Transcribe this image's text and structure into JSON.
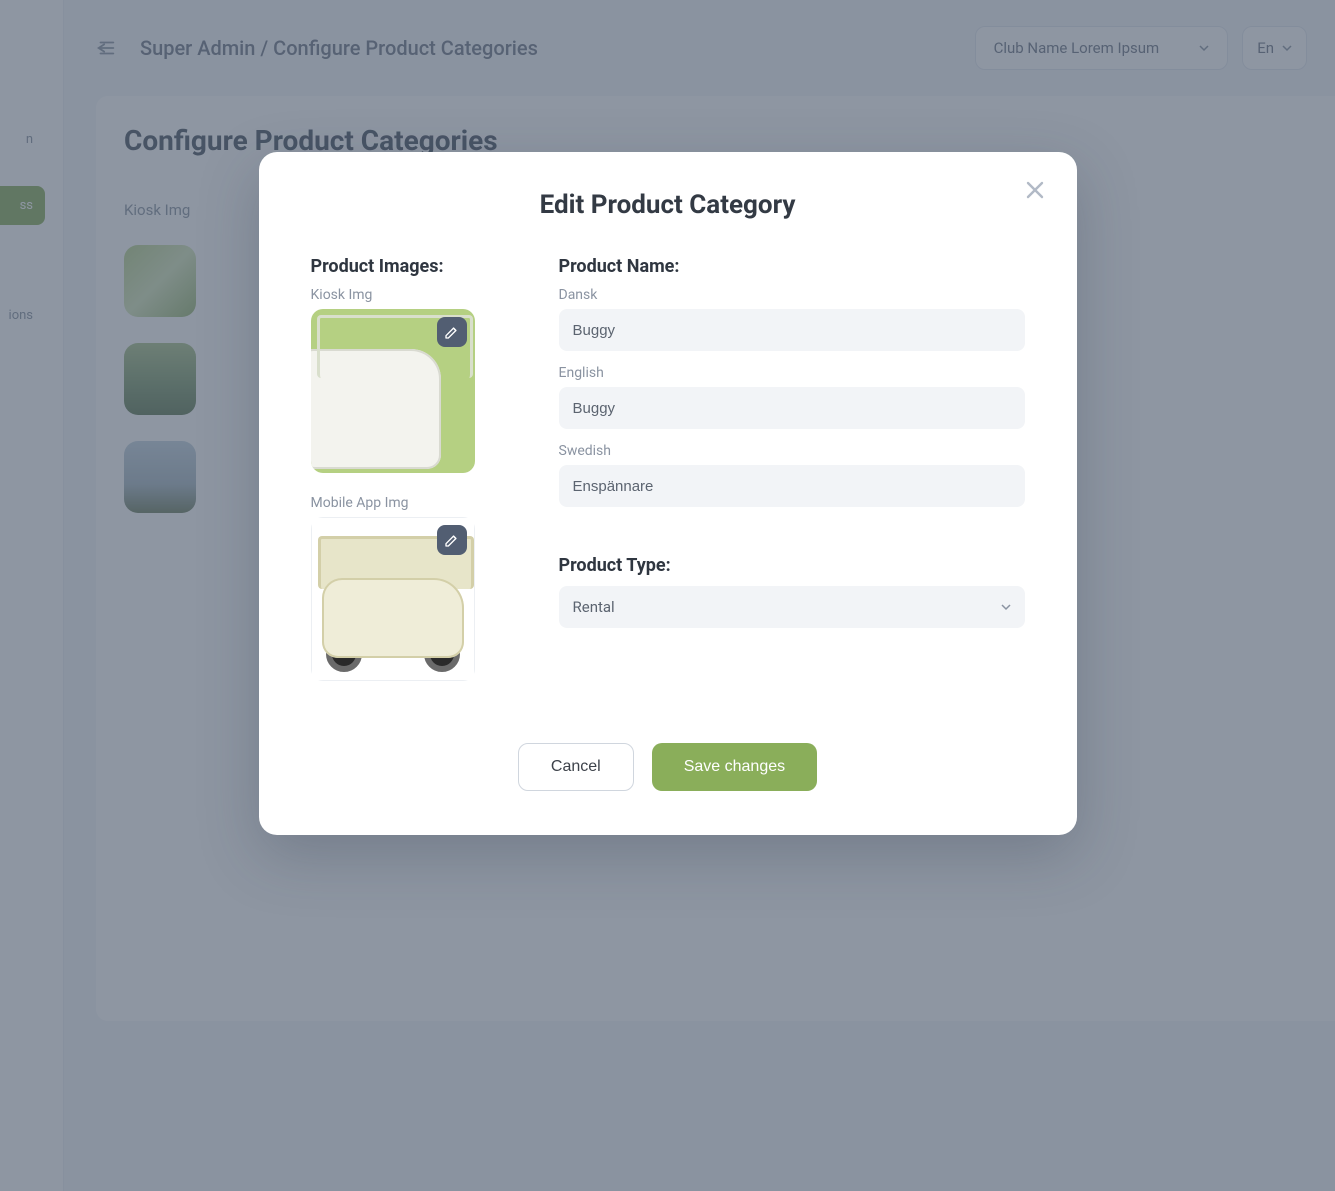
{
  "header": {
    "breadcrumb": "Super Admin / Configure Product Categories",
    "club_selector": "Club Name Lorem Ipsum",
    "lang_selector": "En"
  },
  "sidebar": {
    "item_partial_1": "n",
    "item_active": "ss",
    "item_partial_2": "ions"
  },
  "page": {
    "title": "Configure Product Categories",
    "thumb_col_label": "Kiosk Img"
  },
  "modal": {
    "title": "Edit Product Category",
    "images_section_label": "Product Images:",
    "kiosk_img_label": "Kiosk Img",
    "mobile_img_label": "Mobile App Img",
    "product_name_section_label": "Product Name:",
    "name_fields": {
      "dansk_label": "Dansk",
      "dansk_value": "Buggy",
      "english_label": "English",
      "english_value": "Buggy",
      "swedish_label": "Swedish",
      "swedish_value": "Enspännare"
    },
    "product_type_section_label": "Product Type:",
    "product_type_value": "Rental",
    "cancel_label": "Cancel",
    "save_label": "Save changes"
  },
  "icons": {
    "collapse": "sidebar-collapse-icon",
    "chevron_down": "chevron-down-icon",
    "close": "close-icon",
    "pencil": "pencil-icon"
  }
}
